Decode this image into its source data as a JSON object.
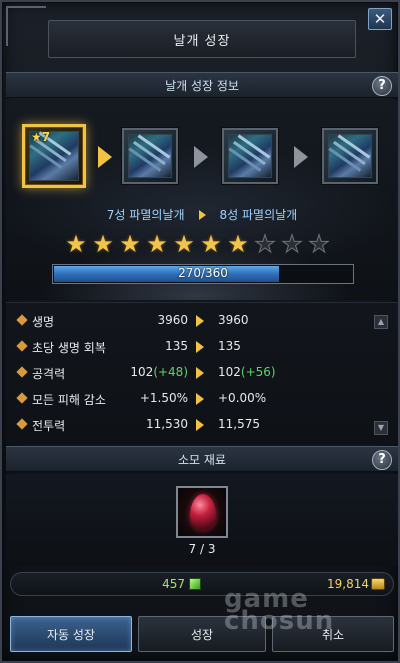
{
  "window": {
    "title": "날개 성장",
    "close_glyph": "✕"
  },
  "info_section": {
    "title": "날개 성장 정보",
    "help_glyph": "?"
  },
  "stages": [
    {
      "star_label": "★7",
      "active": true
    },
    {
      "active": false
    },
    {
      "active": false
    },
    {
      "active": false
    }
  ],
  "upgrade": {
    "current_name": "7성 파멸의날개",
    "next_name": "8성 파멸의날개"
  },
  "stars": {
    "filled": 7,
    "total": 10
  },
  "progress": {
    "text": "270/360",
    "current": 270,
    "max": 360
  },
  "stats": [
    {
      "label": "생명",
      "current": "3960",
      "next": "3960"
    },
    {
      "label": "초당 생명 회복",
      "current": "135",
      "next": "135"
    },
    {
      "label": "공격력",
      "current": "102",
      "current_bonus": "(+48)",
      "next": "102",
      "next_bonus": "(+56)"
    },
    {
      "label": "모든 피해 감소",
      "current": "+1.50%",
      "next": "+0.00%"
    },
    {
      "label": "전투력",
      "current": "11,530",
      "next": "11,575"
    }
  ],
  "materials_section": {
    "title": "소모 재료",
    "help_glyph": "?"
  },
  "material": {
    "icon": "red-egg-icon",
    "count": "7 / 3"
  },
  "currency": {
    "gems": "457",
    "gold": "19,814"
  },
  "buttons": {
    "auto": "자동 성장",
    "grow": "성장",
    "cancel": "취소"
  },
  "watermark": {
    "line1": "game",
    "line2": "chosun"
  },
  "colors": {
    "accent_gold": "#f2c243",
    "bonus_green": "#5fd36a",
    "name_blue": "#9fd3ff"
  }
}
